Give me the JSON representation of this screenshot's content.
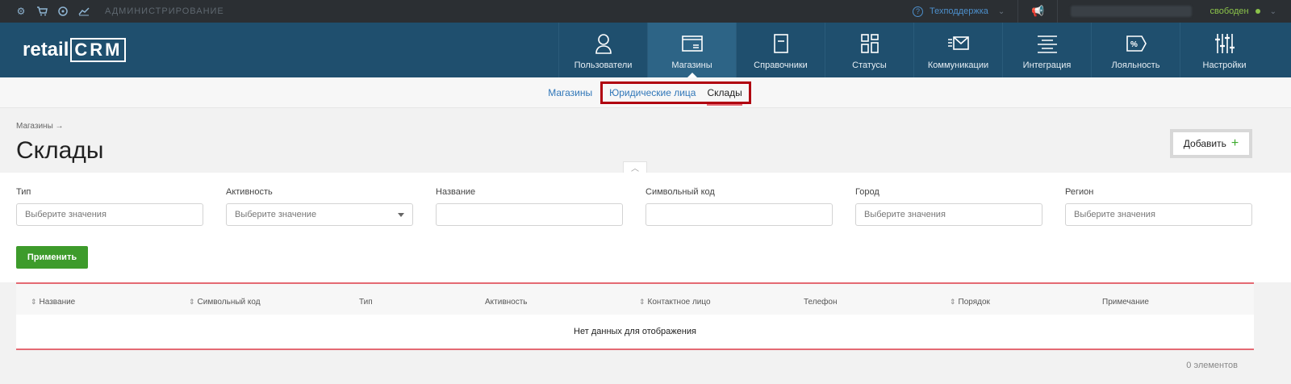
{
  "topbar": {
    "admin_label": "АДМИНИСТРИРОВАНИЕ",
    "support_label": "Техподдержка",
    "status_label": "свободен"
  },
  "logo": {
    "text": "retail",
    "crm": "CRM"
  },
  "nav": [
    {
      "label": "Пользователи",
      "icon": "user-icon"
    },
    {
      "label": "Магазины",
      "icon": "store-icon",
      "active": true
    },
    {
      "label": "Справочники",
      "icon": "document-icon"
    },
    {
      "label": "Статусы",
      "icon": "grid-icon"
    },
    {
      "label": "Коммуникации",
      "icon": "mail-icon"
    },
    {
      "label": "Интеграция",
      "icon": "integration-icon"
    },
    {
      "label": "Лояльность",
      "icon": "percent-tag-icon"
    },
    {
      "label": "Настройки",
      "icon": "sliders-icon"
    }
  ],
  "subnav": {
    "shops": "Магазины",
    "legal": "Юридические лица",
    "warehouses": "Склады"
  },
  "breadcrumb": "Магазины →",
  "page_title": "Склады",
  "add_button": "Добавить",
  "filters": [
    {
      "label": "Тип",
      "placeholder": "Выберите значения"
    },
    {
      "label": "Активность",
      "placeholder": "Выберите значение"
    },
    {
      "label": "Название",
      "placeholder": ""
    },
    {
      "label": "Символьный код",
      "placeholder": ""
    },
    {
      "label": "Город",
      "placeholder": "Выберите значения"
    },
    {
      "label": "Регион",
      "placeholder": "Выберите значения"
    }
  ],
  "apply_button": "Применить",
  "table": {
    "columns": [
      "Название",
      "Символьный код",
      "Тип",
      "Активность",
      "Контактное лицо",
      "Телефон",
      "Порядок",
      "Примечание"
    ],
    "empty": "Нет данных для отображения",
    "total": "0 элементов"
  },
  "colors": {
    "header": "#1f4f6e",
    "accent_red": "#b00010",
    "apply_green": "#3d9b2b"
  }
}
